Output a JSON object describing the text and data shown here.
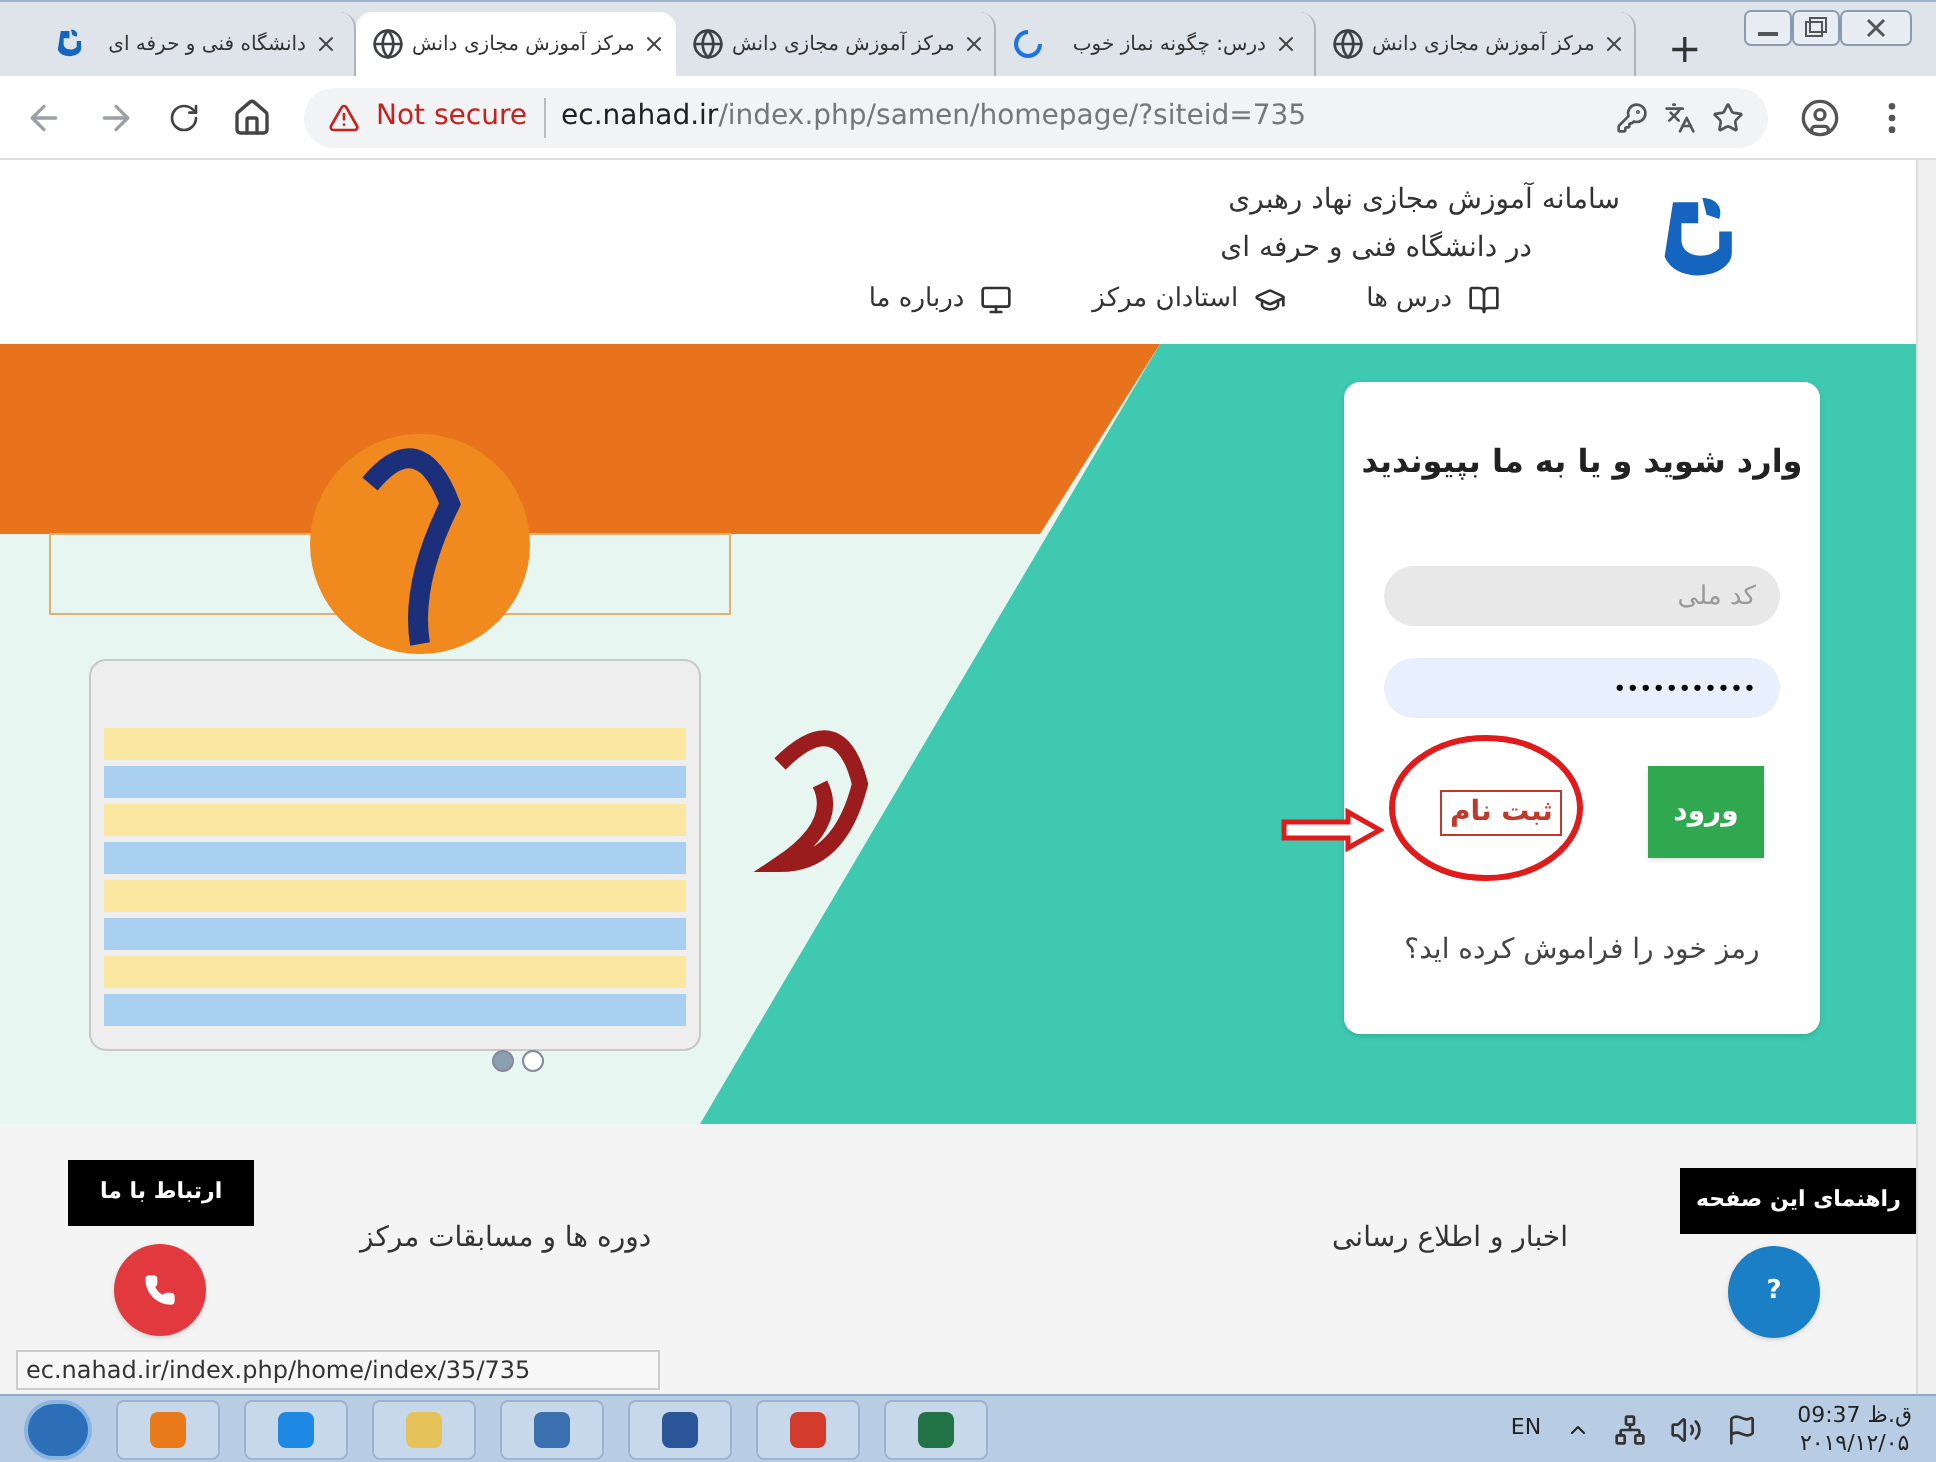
{
  "tabs": [
    {
      "title": "مرکز آموزش مجازی دانش",
      "selected": false,
      "kind": "globe"
    },
    {
      "title": "درس: چگونه نماز خوب",
      "selected": false,
      "kind": "loading"
    },
    {
      "title": "مرکز آموزش مجازی دانش",
      "selected": false,
      "kind": "globe"
    },
    {
      "title": "مرکز آموزش مجازی دانش",
      "selected": true,
      "kind": "globe"
    },
    {
      "title": "دانشگاه فنی و حرفه ای",
      "selected": false,
      "kind": "logo"
    }
  ],
  "new_tab": "+",
  "address_bar": {
    "security": "Not secure",
    "url_host": "ec.nahad.ir",
    "url_path": "/index.php/samen/homepage/?siteid=735"
  },
  "header": {
    "title_line_1": "سامانه آموزش مجازی نهاد رهبری",
    "title_line_2": "در دانشگاه فنی و حرفه ای"
  },
  "nav": [
    {
      "label": "درس ها",
      "kind": "book"
    },
    {
      "label": "استادان مرکز",
      "kind": "cap"
    },
    {
      "label": "درباره ما",
      "kind": "monitor"
    }
  ],
  "slider": {
    "dots": [
      {
        "selected": true
      },
      {
        "selected": false
      }
    ]
  },
  "login": {
    "heading": "وارد شوید و یا به ما بپیوندید",
    "national_id_placeholder": "کد ملی",
    "password_value": "•••••••••••",
    "login_button": "ورود",
    "register_link": "ثبت نام",
    "forgot_password": "رمز خود را فراموش کرده اید؟"
  },
  "sections": [
    "اخبار و اطلاع رسانی",
    "دوره ها و مسابقات مرکز"
  ],
  "help": {
    "tooltip": "راهنمای این صفحه",
    "button": "?"
  },
  "contact": {
    "tooltip": "ارتباط با ما"
  },
  "status_url": "ec.nahad.ir/index.php/home/index/35/735",
  "taskbar": {
    "language": "EN",
    "time": "ق.ظ 09:37",
    "date": "۲۰۱۹/۱۲/۰۵"
  }
}
